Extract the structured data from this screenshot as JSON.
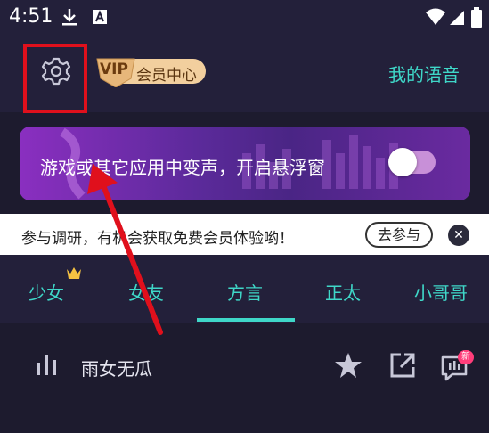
{
  "status_bar": {
    "time": "4:51"
  },
  "header": {
    "vip_badge_text": "VIP",
    "vip_label": "会员中心",
    "my_voice_link": "我的语音"
  },
  "banner": {
    "text": "游戏或其它应用中变声，开启悬浮窗",
    "toggle_on": false
  },
  "survey": {
    "text": "参与调研，有机会获取免费会员体验哟！",
    "join_button": "去参与",
    "close_glyph": "✕"
  },
  "tabs": [
    {
      "label": "少女",
      "selected": false
    },
    {
      "label": "女友",
      "selected": false
    },
    {
      "label": "方言",
      "selected": true
    },
    {
      "label": "正太",
      "selected": false
    },
    {
      "label": "小哥哥",
      "selected": false
    }
  ],
  "list": [
    {
      "name": "雨女无瓜",
      "badge": "新"
    }
  ],
  "colors": {
    "accent": "#3fd7c8",
    "highlight_box": "#e0101c",
    "arrow": "#e0101c",
    "background": "#1d1b2e"
  }
}
